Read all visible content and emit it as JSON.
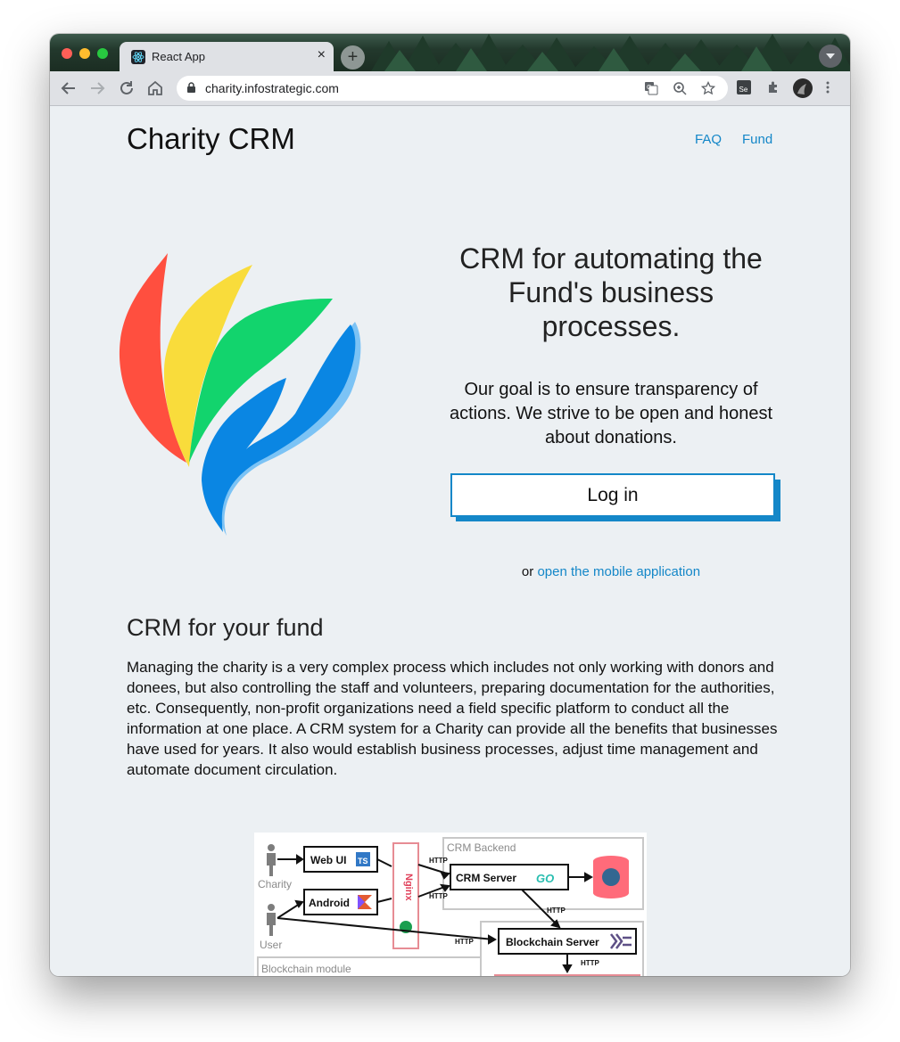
{
  "browser": {
    "tab_title": "React App",
    "tab_close": "×",
    "new_tab": "+",
    "url": "charity.infostrategic.com"
  },
  "site": {
    "brand": "Charity CRM",
    "nav": [
      "FAQ",
      "Fund"
    ]
  },
  "hero": {
    "title": "CRM for automating the Fund's business processes.",
    "text": "Our goal is to ensure transparency of actions. We strive to be open and honest about donations.",
    "login_label": "Log in",
    "mobile_prefix": "or",
    "mobile_link": "open the mobile application"
  },
  "section": {
    "title": "CRM for your fund",
    "body": "Managing the charity is a very complex process which includes not only working with donors and donees, but also controlling the staff and volunteers, preparing documentation for the authorities, etc. Consequently, non-profit organizations need a field specific platform to conduct all the information at one place. A CRM system for a Charity can provide all the benefits that businesses have used for years. It also would establish business processes, adjust time management and automate document circulation."
  },
  "diagram": {
    "charity_label": "Charity",
    "user_label": "User",
    "web_ui": "Web UI",
    "ts_badge": "TS",
    "android": "Android",
    "nginx": "Nginx",
    "http1": "HTTP",
    "http2": "HTTP",
    "http3": "HTTP",
    "http4": "HTTP",
    "http5": "HTTP",
    "crm_backend": "CRM Backend",
    "crm_server": "CRM Server",
    "go_badge": "GO",
    "blockchain_server": "Blockchain Server",
    "blockchain_module": "Blockchain module"
  },
  "colors": {
    "accent": "#1487c8",
    "page_bg": "#ecf0f3",
    "logo_red": "#ff4f3f",
    "logo_yellow": "#f9dc3b",
    "logo_green": "#12d46d",
    "logo_blue": "#0a86e3"
  },
  "icons": [
    "back-arrow-icon",
    "forward-arrow-icon",
    "reload-icon",
    "home-icon",
    "lock-icon",
    "translate-icon",
    "zoom-icon",
    "star-icon",
    "selenium-extension-icon",
    "extensions-puzzle-icon",
    "profile-avatar-icon",
    "kebab-menu-icon"
  ]
}
